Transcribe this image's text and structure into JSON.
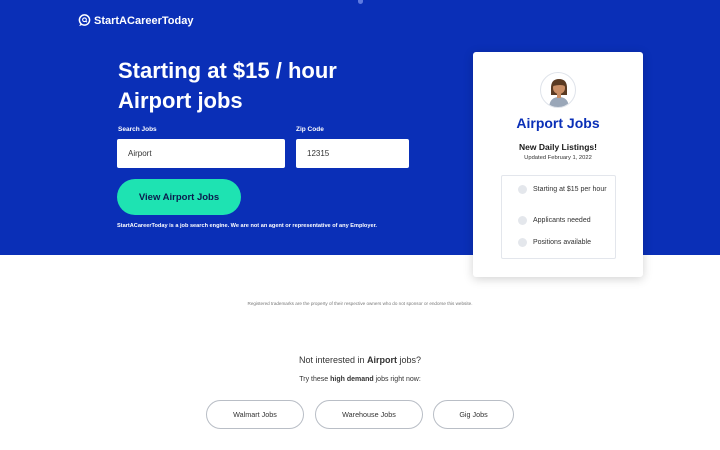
{
  "brand": {
    "name": "StartACareerToday",
    "icon": "search-bubble-icon"
  },
  "hero": {
    "headline_line1": "Starting at $15 / hour",
    "headline_line2": "Airport jobs",
    "search_label": "Search Jobs",
    "search_value": "Airport",
    "zip_label": "Zip Code",
    "zip_value": "12315",
    "cta_label": "View Airport Jobs",
    "disclaimer": "StartACareerToday is a job search engine. We are not an agent or representative of any Employer."
  },
  "card": {
    "title": "Airport Jobs",
    "subtitle": "New Daily Listings!",
    "updated": "Updated February 1, 2022",
    "items": [
      {
        "label": "Starting at $15 per hour"
      },
      {
        "label": "Applicants needed"
      },
      {
        "label": "Positions available"
      }
    ]
  },
  "trademark": "Registered trademarks are the property of their respective owners who do not sponsor or endorse this website.",
  "alt": {
    "not_interested_prefix": "Not interested in",
    "job": "Airport",
    "not_interested_suffix": "jobs?",
    "try_prefix": "Try these",
    "try_bold": "high demand",
    "try_suffix": "jobs right now:",
    "buttons": [
      "Walmart Jobs",
      "Warehouse Jobs",
      "Gig Jobs"
    ]
  },
  "colors": {
    "hero_bg": "#0a2fb7",
    "cta": "#1ee3b2",
    "card_title": "#0a2fb7"
  }
}
